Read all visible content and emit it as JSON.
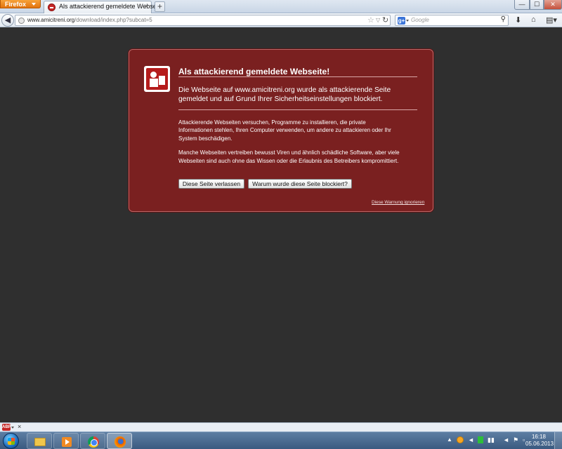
{
  "browser": {
    "menu_button": "Firefox",
    "tab_title": "Als attackierend gemeldete Webseite!",
    "tab_close": "×",
    "new_tab": "+",
    "window_controls": {
      "minimize": "—",
      "maximize": "☐",
      "close": "✕"
    }
  },
  "navbar": {
    "url_domain": "www.amicitreni.org",
    "url_path": "/download/index.php?subcat=5",
    "search_placeholder": "Google",
    "search_engine_logo": "g+",
    "icons": {
      "back": "back-arrow-icon",
      "bookmark": "star-icon",
      "reload": "reload-icon",
      "search": "magnifier-icon",
      "download": "download-arrow-icon",
      "home": "home-icon",
      "menu": "bookmarks-menu-icon"
    }
  },
  "warning": {
    "title": "Als attackierend gemeldete Webseite!",
    "short_desc": "Die Webseite auf www.amicitreni.org wurde als attackierende Seite gemeldet und auf Grund Ihrer Sicherheitseinstellungen blockiert.",
    "long_desc_1": "Attackierende Webseiten versuchen, Programme zu installieren, die private Informationen stehlen, Ihren Computer verwenden, um andere zu attackieren oder Ihr System beschädigen.",
    "long_desc_2": "Manche Webseiten vertreiben bewusst Viren und ähnlich schädliche Software, aber viele Webseiten sind auch ohne das Wissen oder die Erlaubnis des Betreibers kompromittiert.",
    "button_leave": "Diese Seite verlassen",
    "button_why": "Warum wurde diese Seite blockiert?",
    "ignore_link": "Diese Warnung ignorieren",
    "colors": {
      "background": "#7a2020",
      "page": "#2f2f2f"
    }
  },
  "addonbar": {
    "abp_label": "ABP",
    "close": "×"
  },
  "taskbar": {
    "pinned": [
      "explorer-icon",
      "media-player-icon",
      "chrome-icon",
      "firefox-icon"
    ],
    "clock_time": "16:18",
    "clock_date": "05.06.2013"
  }
}
